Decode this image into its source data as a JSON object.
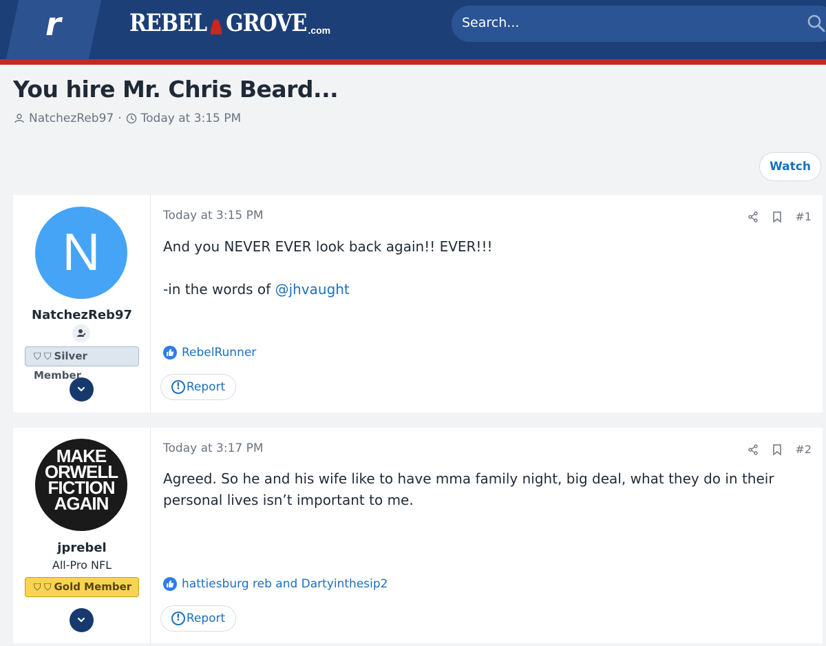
{
  "header": {
    "site_letter": "r",
    "logo_text_left": "REBEL",
    "logo_text_right": "GROVE",
    "logo_suffix": ".com",
    "search_placeholder": "Search..."
  },
  "thread": {
    "title": "You hire Mr. Chris Beard...",
    "author": "NatchezReb97",
    "separator": "·",
    "date": "Today at 3:15 PM",
    "watch_label": "Watch"
  },
  "posts": [
    {
      "avatar_letter": "N",
      "username": "NatchezReb97",
      "user_title": "",
      "badge": "Silver Member",
      "date": "Today at 3:15 PM",
      "number": "#1",
      "body_line1": "And you NEVER EVER look back again!! EVER!!!",
      "body_line2_prefix": "-in the words of ",
      "body_mention": "@jhvaught",
      "reactions": "RebelRunner",
      "report_label": "Report"
    },
    {
      "avatar_lines": [
        "MAKE",
        "ORWELL",
        "FICTION",
        "AGAIN"
      ],
      "username": "jprebel",
      "user_title": "All-Pro NFL",
      "badge": "Gold Member",
      "date": "Today at 3:17 PM",
      "number": "#2",
      "body_line1": "Agreed. So he and his wife like to have mma family night, big deal, what they do in their",
      "body_line2": "personal lives isn’t important to me.",
      "reactions": "hattiesburg reb and Dartyinthesip2",
      "report_label": "Report"
    }
  ],
  "colors": {
    "header_bg": "#1d3f78",
    "header_accent": "#c8281f",
    "link": "#1a6fc0",
    "silver_badge": "#dde5ee",
    "gold_badge": "#f7d454"
  }
}
